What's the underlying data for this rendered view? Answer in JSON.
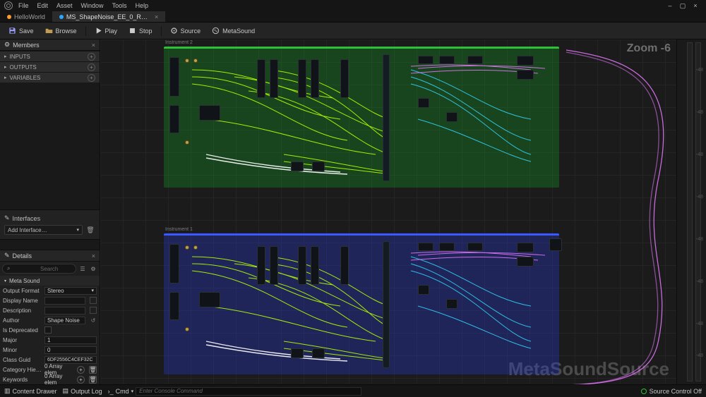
{
  "menubar": {
    "items": [
      "File",
      "Edit",
      "Asset",
      "Window",
      "Tools",
      "Help"
    ]
  },
  "window_controls": {
    "minimize": "–",
    "maximize": "▢",
    "close": "×"
  },
  "asset_tabs": {
    "level": {
      "label": "HelloWorld"
    },
    "editor": {
      "label": "MS_ShapeNoise_EE_0_R…",
      "close": "×"
    }
  },
  "toolbar": {
    "save": "Save",
    "browse": "Browse",
    "play": "Play",
    "stop": "Stop",
    "source": "Source",
    "metasound": "MetaSound"
  },
  "members": {
    "title": "Members",
    "close": "×",
    "sections": {
      "inputs": "INPUTS",
      "outputs": "OUTPUTS",
      "variables": "VARIABLES"
    }
  },
  "interfaces": {
    "title": "Interfaces",
    "add_label": "Add Interface…",
    "trash_title": "Remove"
  },
  "details": {
    "title": "Details",
    "close": "×",
    "search_placeholder": "Search",
    "category": "Meta Sound",
    "rows": {
      "output_format": {
        "label": "Output Format",
        "value": "Stereo"
      },
      "display_name": {
        "label": "Display Name",
        "value": ""
      },
      "description": {
        "label": "Description",
        "value": ""
      },
      "author": {
        "label": "Author",
        "value": "Shape Noise"
      },
      "is_deprecated": {
        "label": "Is Deprecated",
        "checked": false
      },
      "major": {
        "label": "Major",
        "value": "1"
      },
      "minor": {
        "label": "Minor",
        "value": "0"
      },
      "class_guid": {
        "label": "Class Guid",
        "value": "6DF2556C4CEF32C"
      },
      "category_hier": {
        "label": "Category Hier…",
        "count": "0 Array elem"
      },
      "keywords": {
        "label": "Keywords",
        "count": "0 Array elem"
      }
    }
  },
  "graph": {
    "zoom": "Zoom -6",
    "watermark": "MetaSoundSource",
    "regions": {
      "top": {
        "label": "Instrument 2"
      },
      "bottom": {
        "label": "Instrument 1"
      }
    }
  },
  "status": {
    "content_drawer": "Content Drawer",
    "output_log": "Output Log",
    "cmd_label": "Cmd",
    "cmd_placeholder": "Enter Console Command",
    "source_control": "Source Control Off"
  },
  "ruler_labels": [
    "-48",
    "-48",
    "-48",
    "-48",
    "-48",
    "-48",
    "-48",
    "-48"
  ]
}
